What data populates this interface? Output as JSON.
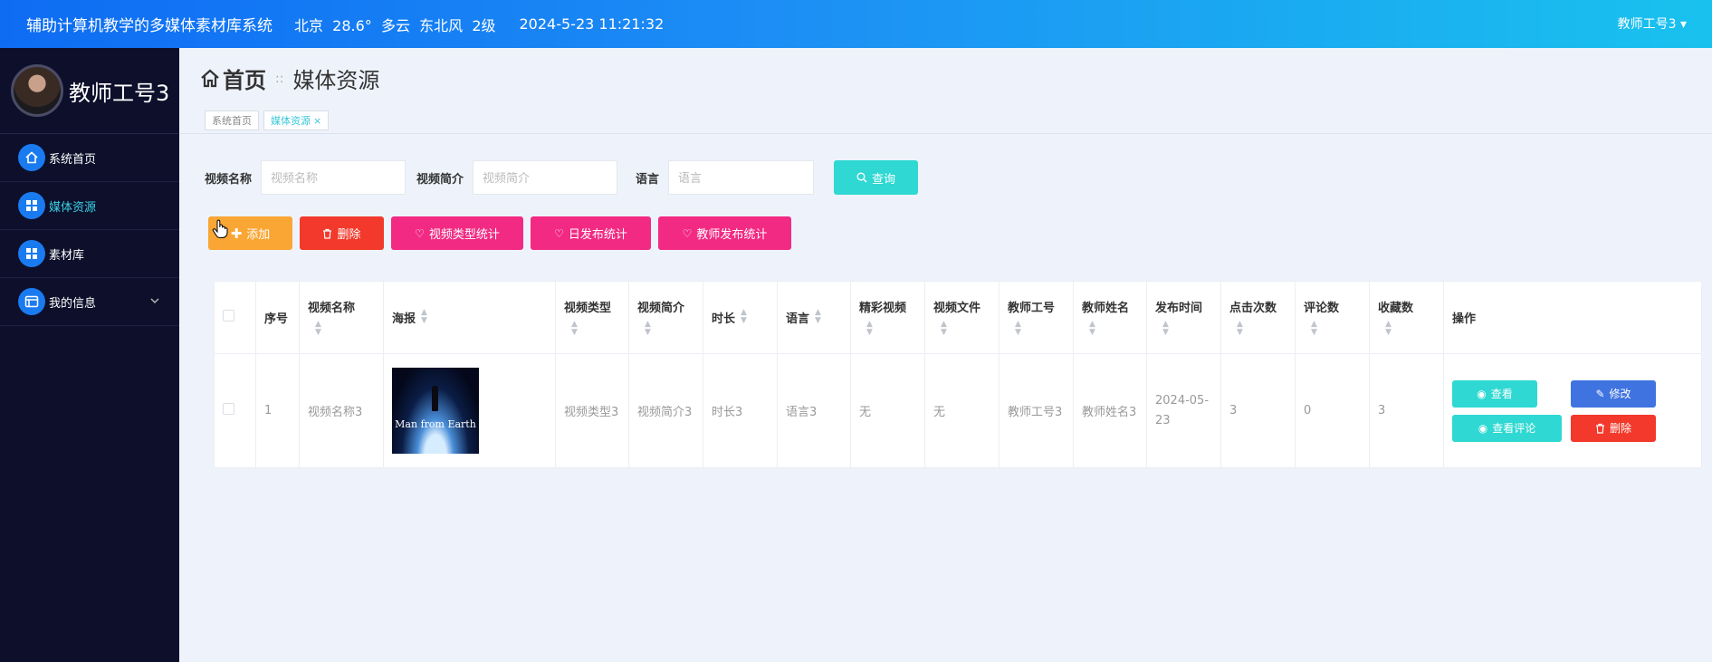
{
  "topbar": {
    "title": "辅助计算机教学的多媒体素材库系统",
    "weather": "北京  28.6°  多云  东北风  2级",
    "datetime": "2024-5-23 11:21:32",
    "user_menu": "教师工号3 ▾"
  },
  "sidebar": {
    "profile_name": "教师工号3",
    "items": [
      {
        "label": "系统首页",
        "icon": "home-icon"
      },
      {
        "label": "媒体资源",
        "icon": "grid-icon"
      },
      {
        "label": "素材库",
        "icon": "grid-icon"
      },
      {
        "label": "我的信息",
        "icon": "card-icon"
      }
    ]
  },
  "header": {
    "home": "首页",
    "separator": "::",
    "current": "媒体资源",
    "tags": [
      {
        "label": "系统首页"
      },
      {
        "label": "媒体资源"
      }
    ],
    "tag_close": "×"
  },
  "search": {
    "name_label": "视频名称",
    "name_placeholder": "视频名称",
    "intro_label": "视频简介",
    "intro_placeholder": "视频简介",
    "lang_label": "语言",
    "lang_placeholder": "语言",
    "button": "查询"
  },
  "actions": {
    "add": "添加",
    "delete": "删除",
    "type_stats": "视频类型统计",
    "daily_stats": "日发布统计",
    "teacher_stats": "教师发布统计"
  },
  "table": {
    "headers": [
      "序号",
      "视频名称",
      "海报",
      "视频类型",
      "视频简介",
      "时长",
      "语言",
      "精彩视频",
      "视频文件",
      "教师工号",
      "教师姓名",
      "发布时间",
      "点击次数",
      "评论数",
      "收藏数",
      "操作"
    ],
    "sort_glyph": "▲\n▼",
    "rows": [
      {
        "index": "1",
        "name": "视频名称3",
        "poster_title": "Man from Earth",
        "type": "视频类型3",
        "intro": "视频简介3",
        "duration": "时长3",
        "language": "语言3",
        "highlight": "无",
        "file": "无",
        "teacher_id": "教师工号3",
        "teacher_name": "教师姓名3",
        "publish_time": "2024-05-23",
        "clicks": "3",
        "comments": "0",
        "favorites": "3"
      }
    ],
    "ops": {
      "view": "查看",
      "edit": "修改",
      "view_comments": "查看评论",
      "delete": "删除"
    }
  },
  "colors": {
    "topbar_start": "#0e6cf3",
    "topbar_end": "#19c2ee",
    "sidebar_bg": "#0d0f2b",
    "active_text": "#38d3e6",
    "add_btn": "#f9a634",
    "delete_btn": "#f2392b",
    "stats_btn": "#f22a83",
    "search_btn": "#2fd8d2",
    "edit_btn": "#3f73e0"
  }
}
